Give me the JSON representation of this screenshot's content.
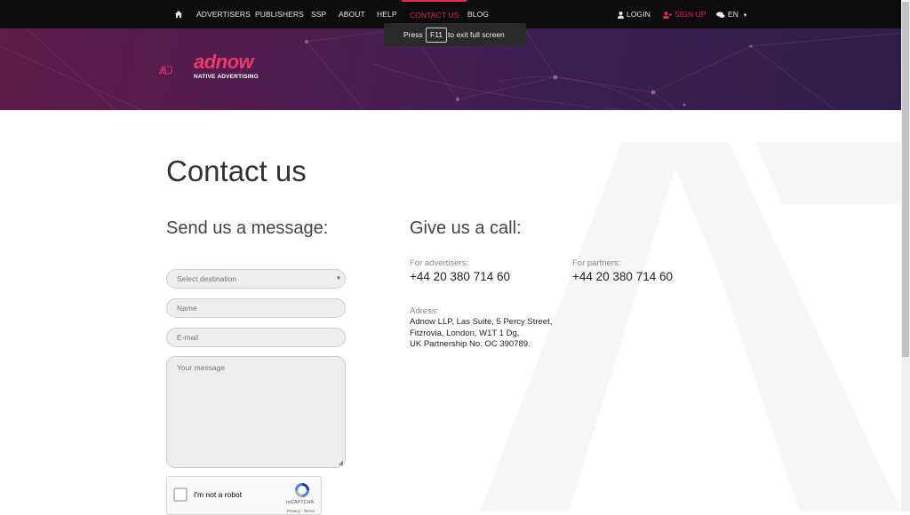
{
  "nav": {
    "items": [
      "ADVERTISERS",
      "PUBLISHERS",
      "SSP",
      "ABOUT",
      "HELP",
      "CONTACT US",
      "BLOG"
    ],
    "active": "CONTACT US",
    "login": "LOGIN",
    "signup": "SIGN UP",
    "language": "EN"
  },
  "toast": {
    "press": "Press",
    "key": "F11",
    "rest": "to exit full screen"
  },
  "logo": {
    "word": "adnow",
    "tagline": "NATIVE ADVERTISING"
  },
  "page": {
    "title": "Contact us"
  },
  "form": {
    "heading": "Send us a message:",
    "destination_placeholder": "Select destination",
    "name_placeholder": "Name",
    "email_placeholder": "E-mail",
    "message_placeholder": "Your message",
    "recaptcha": {
      "label": "I'm not a robot",
      "brand": "reCAPTCHA",
      "terms": "Privacy - Terms"
    }
  },
  "call": {
    "heading": "Give us a call:",
    "advertisers_label": "For advertisers:",
    "advertisers_phone": "+44 20 380 714 60",
    "partners_label": "For partners:",
    "partners_phone": "+44 20 380 714 60",
    "address_label": "Adress:",
    "address_lines": [
      "Adnow LLP, Las Suite, 5 Percy Street,",
      "Fitzrovia, London, W1T 1 Dg,",
      "UK Partnership No. OC 390789."
    ]
  },
  "colors": {
    "accent": "#e8264f",
    "nav_bg": "#0c0c0c",
    "banner": "#4d1d4f"
  }
}
